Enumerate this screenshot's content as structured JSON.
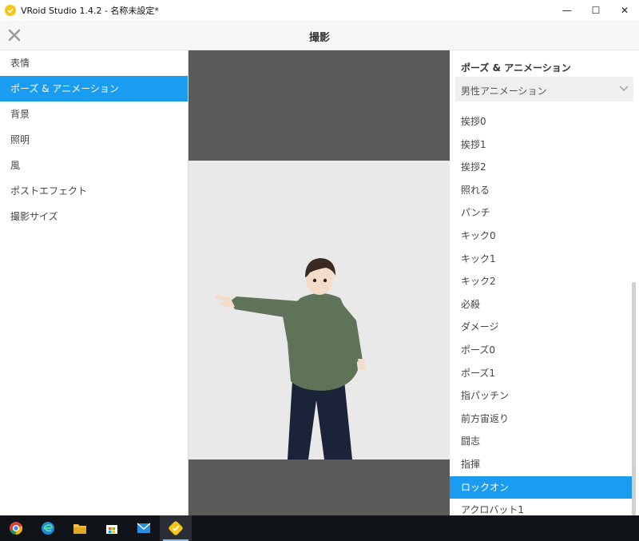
{
  "window": {
    "title": "VRoid Studio 1.4.2 - 名称未設定*",
    "minimize": "—",
    "maximize": "☐",
    "close": "✕"
  },
  "header": {
    "title": "撮影"
  },
  "sidebar": {
    "items": [
      {
        "label": "表情"
      },
      {
        "label": "ポーズ & アニメーション",
        "active": true
      },
      {
        "label": "背景"
      },
      {
        "label": "照明"
      },
      {
        "label": "風"
      },
      {
        "label": "ポストエフェクト"
      },
      {
        "label": "撮影サイズ"
      }
    ]
  },
  "panel": {
    "title": "ポーズ & アニメーション",
    "select": {
      "value": "男性アニメーション"
    },
    "items": [
      {
        "label": "挨拶0"
      },
      {
        "label": "挨拶1"
      },
      {
        "label": "挨拶2"
      },
      {
        "label": "照れる"
      },
      {
        "label": "パンチ"
      },
      {
        "label": "キック0"
      },
      {
        "label": "キック1"
      },
      {
        "label": "キック2"
      },
      {
        "label": "必殺"
      },
      {
        "label": "ダメージ"
      },
      {
        "label": "ポーズ0"
      },
      {
        "label": "ポーズ1"
      },
      {
        "label": "指パッチン"
      },
      {
        "label": "前方宙返り"
      },
      {
        "label": "闘志"
      },
      {
        "label": "指揮"
      },
      {
        "label": "ロックオン",
        "active": true
      },
      {
        "label": "アクロバット1"
      }
    ]
  },
  "taskbar": {
    "icons": [
      "chrome-icon",
      "edge-icon",
      "file-explorer-icon",
      "store-icon",
      "mail-icon",
      "vroid-icon"
    ]
  },
  "colors": {
    "accent": "#1a9cf0",
    "viewport_bg": "#5a5a5a",
    "canvas_bg": "#e9e9e9"
  }
}
